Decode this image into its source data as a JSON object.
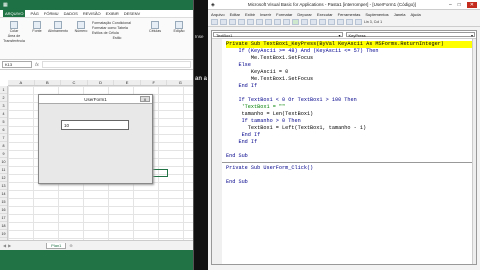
{
  "excel": {
    "tabs": [
      "ARQUIVO",
      "PÁG",
      "FÓRMU",
      "DADOS",
      "REVISÃO",
      "EXIBIR",
      "DESENV"
    ],
    "ribbon": {
      "groups": [
        {
          "label": "Área de Transferência",
          "items": [
            "Colar"
          ]
        },
        {
          "label": "Fonte",
          "items": [
            "Fonte"
          ]
        },
        {
          "label": "Alinhamento",
          "items": [
            "Alinhamento"
          ]
        },
        {
          "label": "Número",
          "items": [
            "Número"
          ]
        },
        {
          "label": "Estilo",
          "items": [
            "Formatação Condicional",
            "Formatar como Tabela",
            "Estilos de Célula"
          ]
        },
        {
          "label": "Células",
          "items": [
            "Células"
          ]
        },
        {
          "label": "Edição",
          "items": [
            "Edição"
          ]
        }
      ]
    },
    "namebox": "K13",
    "fx": "fx",
    "columns": [
      "A",
      "B",
      "C",
      "D",
      "E",
      "F",
      "G"
    ],
    "rows": [
      "1",
      "2",
      "3",
      "4",
      "5",
      "6",
      "7",
      "8",
      "9",
      "10",
      "11",
      "12",
      "13",
      "14",
      "15",
      "16",
      "17",
      "18",
      "19"
    ],
    "userform": {
      "title": "UserForm1",
      "close": "X",
      "textbox_value": "10"
    },
    "sheet_tab": "Plan1"
  },
  "gap_text": {
    "line1": "Inse",
    "line2": "an a"
  },
  "vbe": {
    "title": "Microsoft Visual Basic for Applications - Pasta1 [interromper] - [UserForm1 (Código)]",
    "menu": [
      "Arquivo",
      "Editar",
      "Exibir",
      "Inserir",
      "Formatar",
      "Depurar",
      "Executar",
      "Ferramentas",
      "Suplementos",
      "Janela",
      "Ajuda"
    ],
    "toolbar_status": "Lin 3, Col 1",
    "object_combo": "TextBox1",
    "proc_combo": "KeyPress",
    "code_lines": [
      {
        "text": "Private Sub TextBox1_KeyPress(ByVal KeyAscii As MSForms.ReturnInteger)",
        "style": "hl"
      },
      {
        "text": "    If (KeyAscii >= 48) And (KeyAscii <= 57) Then",
        "style": "kw"
      },
      {
        "text": "        Me.TextBox1.SetFocus",
        "style": ""
      },
      {
        "text": "    Else",
        "style": "kw"
      },
      {
        "text": "        KeyAscii = 0",
        "style": ""
      },
      {
        "text": "        Me.TextBox1.SetFocus",
        "style": ""
      },
      {
        "text": "    End If",
        "style": "kw"
      },
      {
        "text": "",
        "style": ""
      },
      {
        "text": "    If TextBox1 < 0 Or TextBox1 > 100 Then",
        "style": "kw"
      },
      {
        "text": "     'TextBox1 = \"\"",
        "style": "cm"
      },
      {
        "text": "     tamanho = Len(TextBox1)",
        "style": ""
      },
      {
        "text": "     If tamanho > 0 Then",
        "style": "kw"
      },
      {
        "text": "       TextBox1 = Left(TextBox1, tamanho - 1)",
        "style": ""
      },
      {
        "text": "     End If",
        "style": "kw"
      },
      {
        "text": "    End If",
        "style": "kw"
      },
      {
        "text": "",
        "style": ""
      },
      {
        "text": "End Sub",
        "style": "kw"
      }
    ],
    "code_lines_2": [
      {
        "text": "Private Sub UserForm_Click()",
        "style": "kw"
      },
      {
        "text": "",
        "style": ""
      },
      {
        "text": "End Sub",
        "style": "kw"
      }
    ]
  }
}
